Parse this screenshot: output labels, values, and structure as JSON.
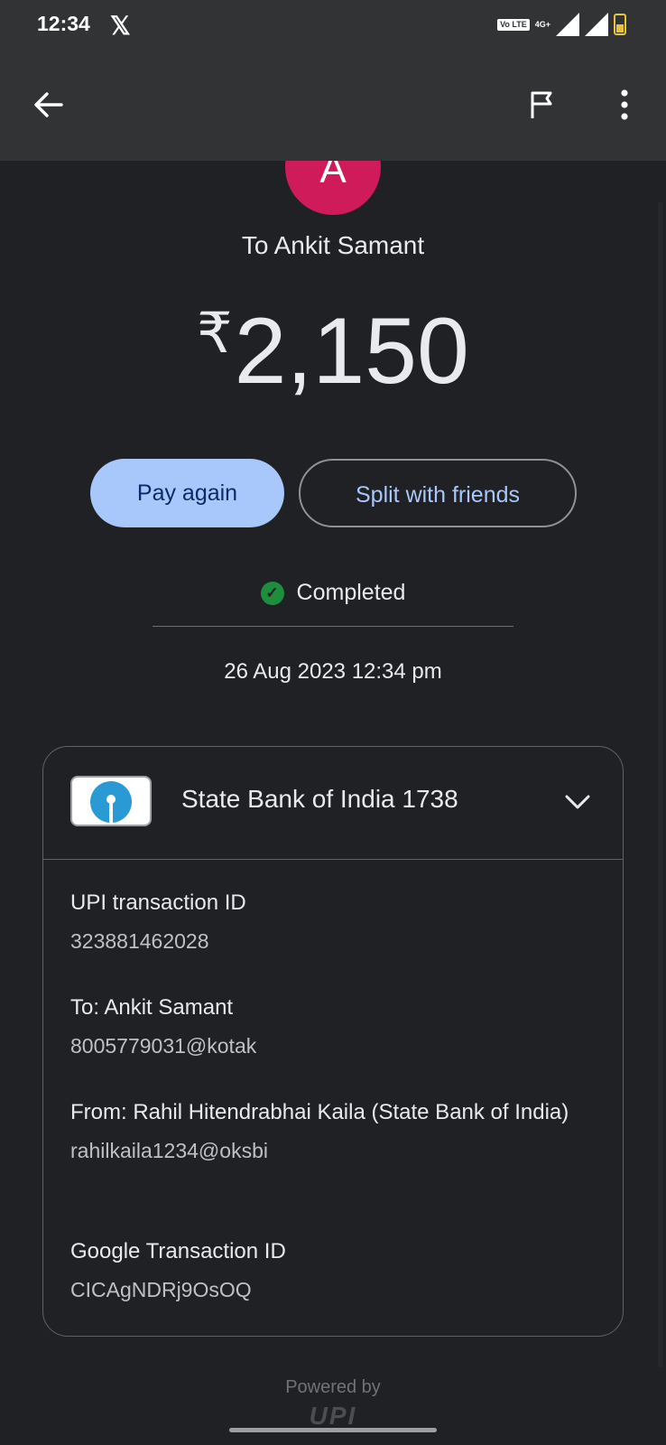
{
  "status_bar": {
    "time": "12:34",
    "app_icon": "x-logo-icon",
    "network": "4G+",
    "volte": "Vo LTE"
  },
  "app_bar": {
    "back_icon": "back-arrow-icon",
    "flag_icon": "flag-icon",
    "more_icon": "more-vert-icon"
  },
  "recipient": {
    "avatar_letter": "A",
    "avatar_color": "#cf1b5a",
    "to_label": "To Ankit Samant"
  },
  "payment": {
    "currency": "₹",
    "amount": "2,150"
  },
  "actions": {
    "pay_again": "Pay again",
    "split": "Split with friends"
  },
  "status": {
    "text": "Completed",
    "color": "#1e8e3e"
  },
  "datetime": "26 Aug 2023 12:34 pm",
  "details": {
    "bank": "State Bank of India 1738",
    "fields": [
      {
        "label": "UPI transaction ID",
        "value": "323881462028"
      },
      {
        "label": "To: Ankit Samant",
        "value": "8005779031@kotak"
      },
      {
        "label": "From: Rahil Hitendrabhai Kaila (State Bank of India)",
        "value": "rahilkaila1234@oksbi"
      },
      {
        "label": "Google Transaction ID",
        "value": "CICAgNDRj9OsOQ"
      }
    ]
  },
  "footer": {
    "powered_by": "Powered by",
    "upi_logo": "UPI"
  }
}
